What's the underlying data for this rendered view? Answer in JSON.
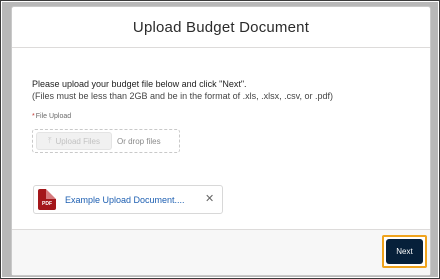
{
  "modal": {
    "title": "Upload Budget Document",
    "instruction": "Please upload your budget file below and click \"Next\".",
    "instruction_sub": "(Files must be less than 2GB and be in the format of .xls, .xlsx, .csv, or .pdf)",
    "field_label": "File Upload",
    "required_marker": "*",
    "upload_button_label": "Upload Files",
    "upload_icon": "upload-icon",
    "drop_text": "Or drop files",
    "file": {
      "name": "Example Upload Document....",
      "type_label": "PDF",
      "icon": "pdf-file-icon",
      "remove_icon": "close-icon"
    },
    "footer": {
      "next_label": "Next",
      "highlight_color": "#f0a31c"
    }
  }
}
